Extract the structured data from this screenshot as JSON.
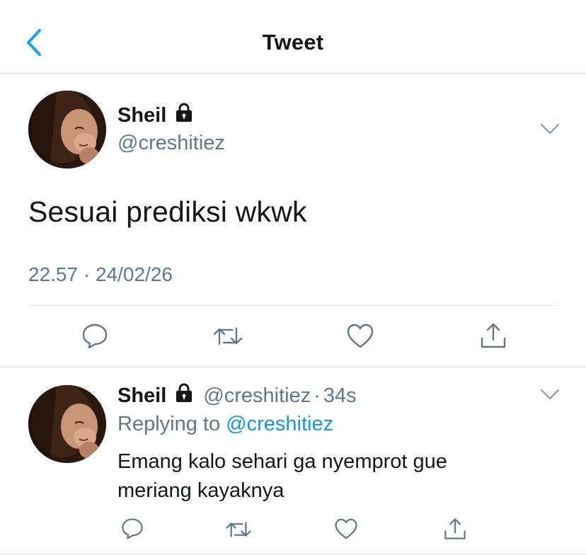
{
  "header": {
    "title": "Tweet",
    "back_icon": "chevron-left-icon"
  },
  "tweet": {
    "author": {
      "name": "Sheil",
      "handle": "@creshitiez",
      "protected_icon": "lock-icon"
    },
    "text": "Sesuai prediksi wkwk",
    "time": "22.57",
    "separator": "·",
    "date": "24/02/26",
    "actions": [
      "reply-icon",
      "retweet-icon",
      "like-icon",
      "share-icon"
    ]
  },
  "reply": {
    "author": {
      "name": "Sheil",
      "handle": "@creshitiez"
    },
    "separator": "·",
    "age": "34s",
    "replying_prefix": "Replying to",
    "replying_handle": "@creshitiez",
    "lines": [
      "Emang kalo sehari ga nyemprot gue",
      "meriang kayaknya"
    ],
    "actions": [
      "reply-icon",
      "retweet-icon",
      "like-icon",
      "share-icon"
    ]
  },
  "colors": {
    "accent": "#1da1f2",
    "link": "#1b95e0",
    "muted": "#657786",
    "divider": "#e1e4e8",
    "text": "#14171a"
  }
}
